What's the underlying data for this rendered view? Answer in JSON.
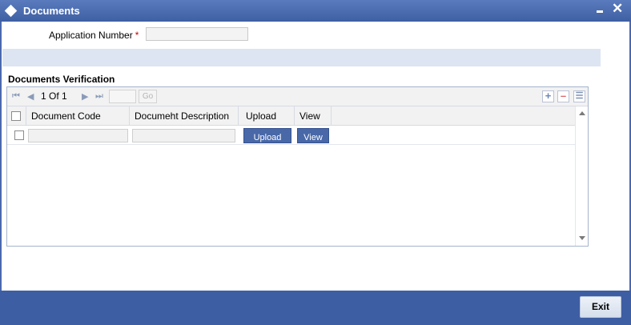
{
  "window": {
    "title": "Documents",
    "minimize_label": "–",
    "close_label": "✕"
  },
  "form": {
    "application_number_label": "Application Number",
    "required_mark": "*",
    "application_number_value": ""
  },
  "section": {
    "title": "Documents Verification"
  },
  "grid": {
    "pager": {
      "current_page": "1",
      "of_label": "Of",
      "total_pages": "1",
      "go_label": "Go",
      "page_input_value": ""
    },
    "columns": [
      "Document Code",
      "Documeht Description",
      "Upload",
      "View"
    ],
    "rows": [
      {
        "document_code": "",
        "document_description": "",
        "upload_label": "Upload",
        "view_label": "View"
      }
    ]
  },
  "footer": {
    "exit_label": "Exit"
  },
  "icons": {
    "title": "diamond-icon",
    "first": "first-page-icon",
    "prev": "prev-page-icon",
    "next": "next-page-icon",
    "last": "last-page-icon",
    "add": "add-row-icon",
    "delete": "delete-row-icon",
    "single_view": "single-view-icon"
  },
  "colors": {
    "titlebar": "#4a6aae",
    "footer": "#3e5ea3",
    "band": "#dde5f3",
    "button": "#4868a8",
    "required": "#cc0000"
  }
}
